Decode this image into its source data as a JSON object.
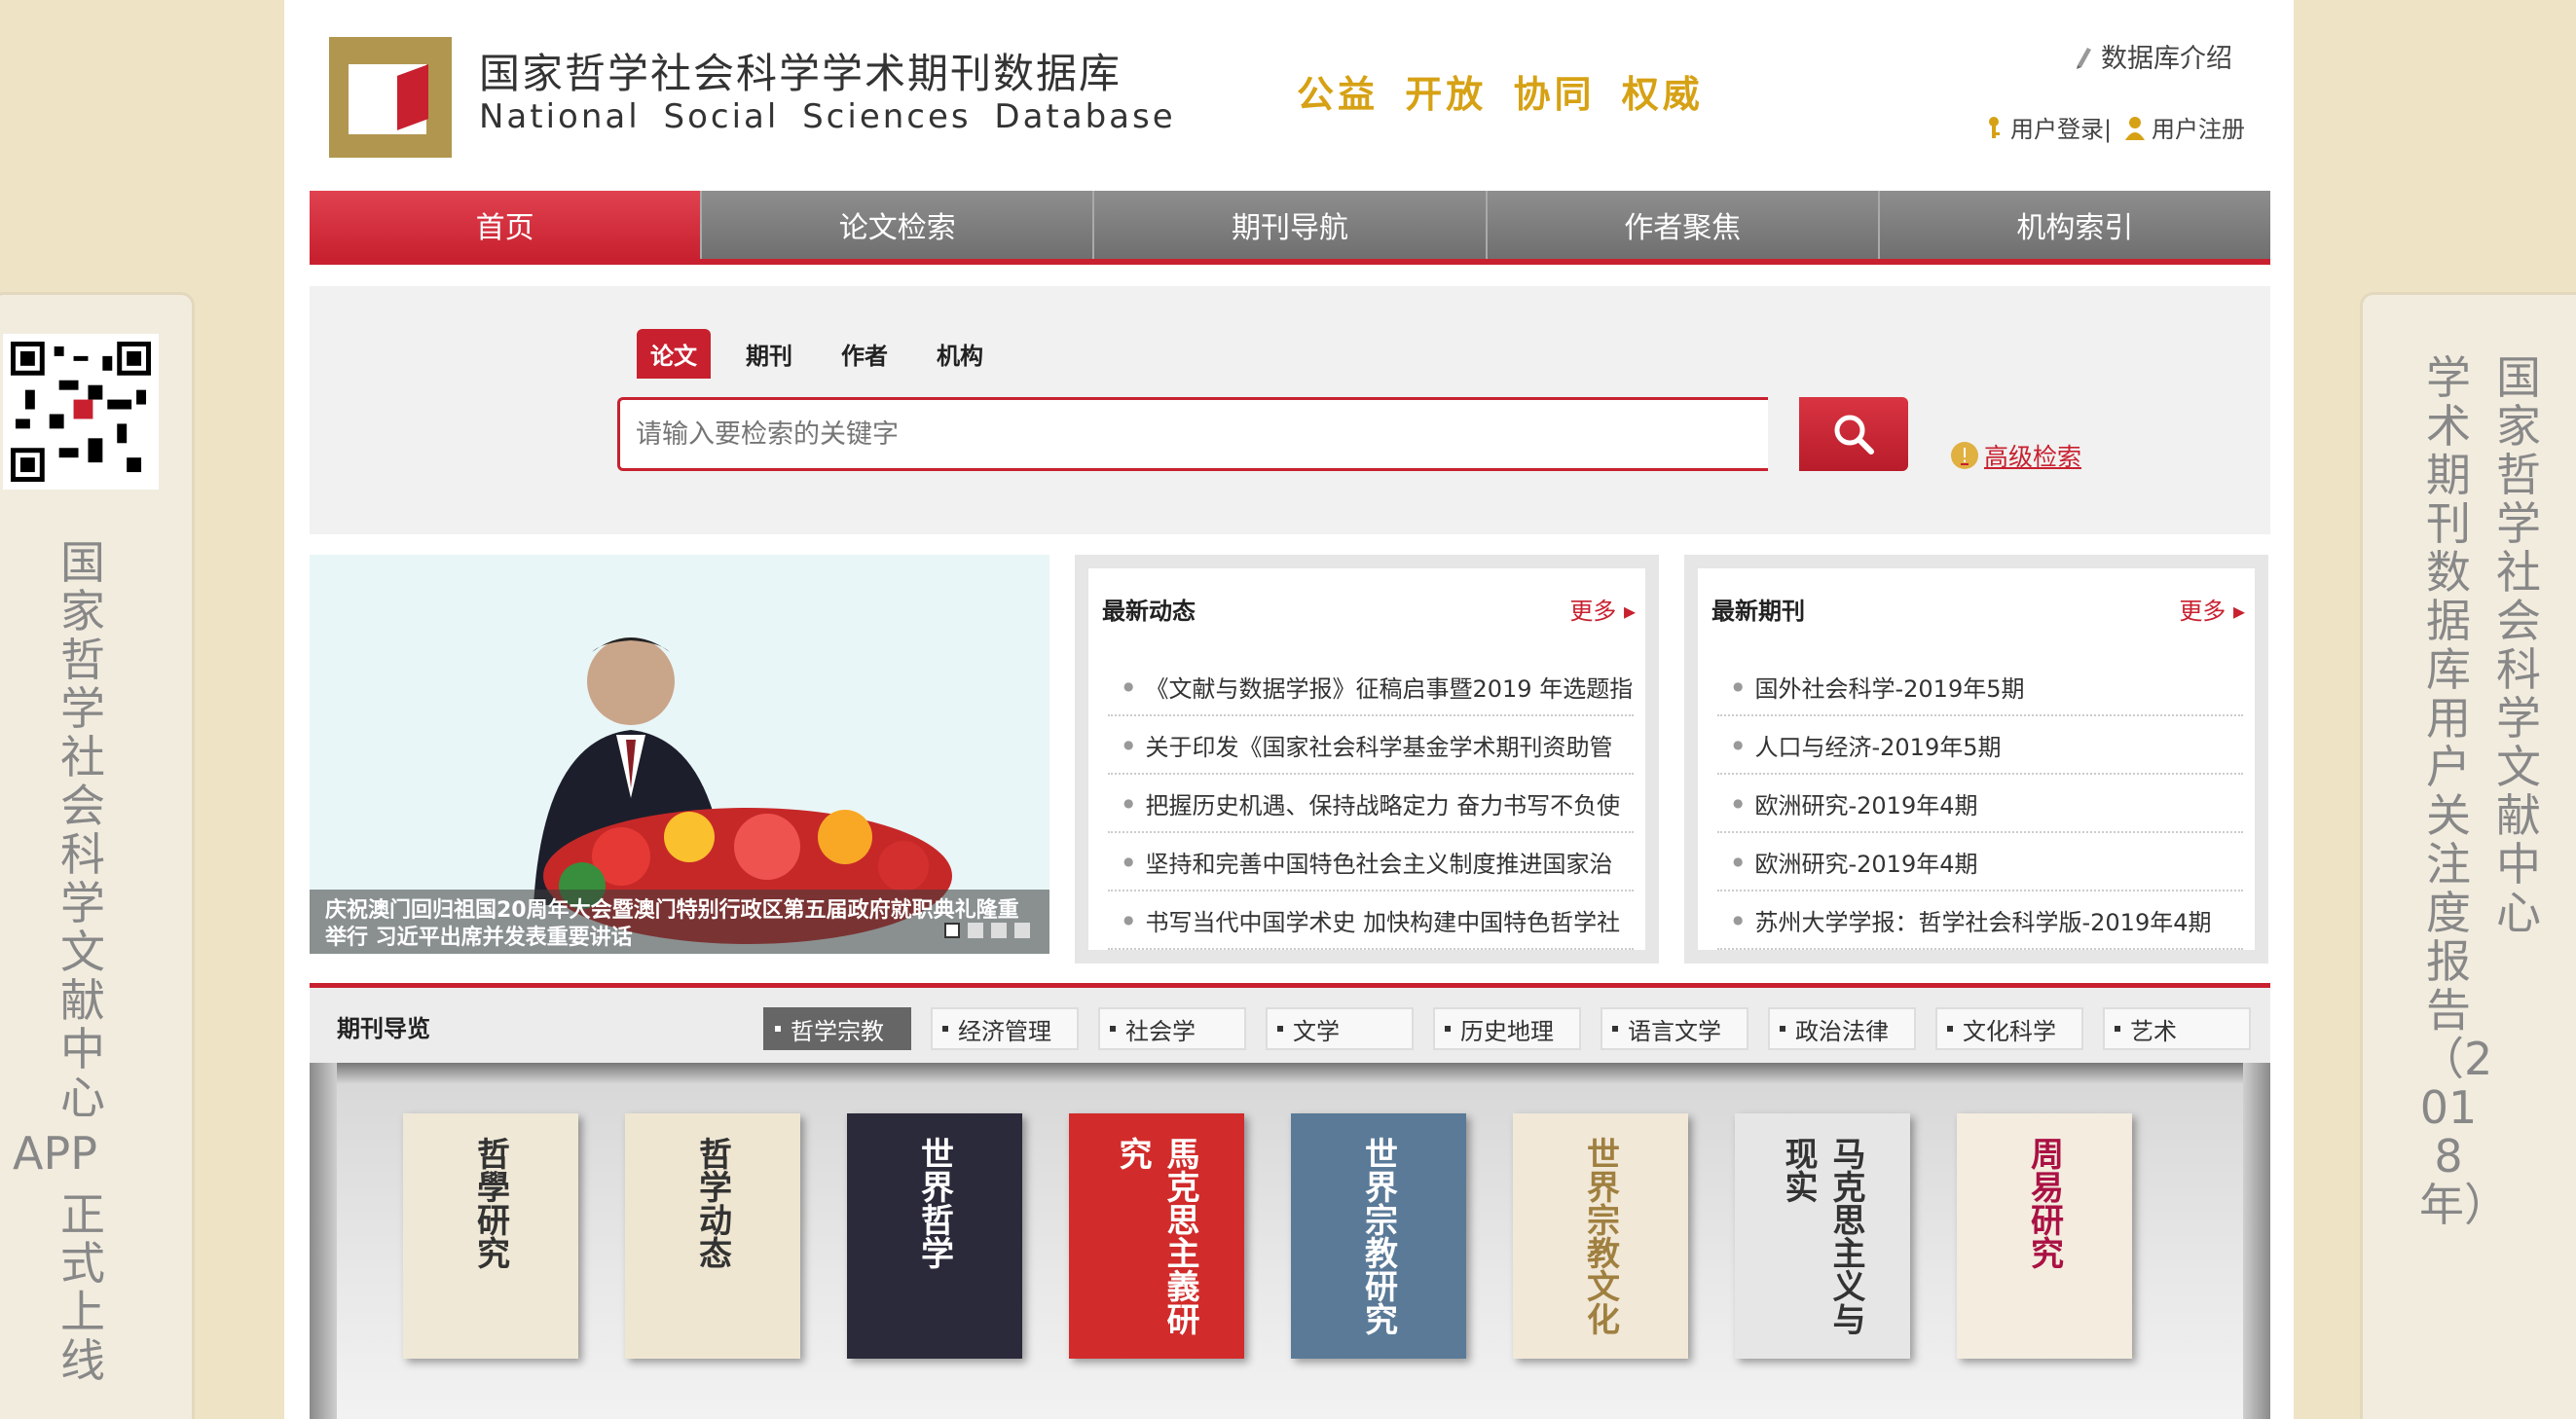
{
  "header": {
    "title_cn": "国家哲学社会科学学术期刊数据库",
    "title_en": "National Social Sciences Database",
    "slogan": "公益 开放 协同 权威",
    "intro_link": "数据库介绍",
    "login_link": "用户登录|",
    "register_link": "用户注册"
  },
  "nav": {
    "items": [
      "首页",
      "论文检索",
      "期刊导航",
      "作者聚焦",
      "机构索引"
    ]
  },
  "search": {
    "tabs": [
      "论文",
      "期刊",
      "作者",
      "机构"
    ],
    "placeholder": "请输入要检索的关键字",
    "advanced": "高级检索"
  },
  "banner": {
    "caption": "庆祝澳门回归祖国20周年大会暨澳门特别行政区第五届政府就职典礼隆重举行 习近平出席并发表重要讲话"
  },
  "news": {
    "title": "最新动态",
    "more": "更多 ▸",
    "items": [
      "《文献与数据学报》征稿启事暨2019 年选题指",
      "关于印发《国家社会科学基金学术期刊资助管",
      "把握历史机遇、保持战略定力 奋力书写不负使",
      "坚持和完善中国特色社会主义制度推进国家治",
      "书写当代中国学术史 加快构建中国特色哲学社"
    ]
  },
  "journals": {
    "title": "最新期刊",
    "more": "更多 ▸",
    "items": [
      "国外社会科学-2019年5期",
      "人口与经济-2019年5期",
      "欧洲研究-2019年4期",
      "欧洲研究-2019年4期",
      "苏州大学学报：哲学社会科学版-2019年4期"
    ]
  },
  "guide": {
    "title": "期刊导览",
    "categories": [
      "哲学宗教",
      "经济管理",
      "社会学",
      "文学",
      "历史地理",
      "语言文学",
      "政治法律",
      "文化科学",
      "艺术"
    ]
  },
  "books": [
    {
      "title": "哲學研究",
      "color": "#efe8d6"
    },
    {
      "title": "哲学动态",
      "color": "#efe6d2"
    },
    {
      "title": "世界哲学",
      "color": "#2b2a3a"
    },
    {
      "title": "馬克思主義研究",
      "color": "#d22b2b"
    },
    {
      "title": "世界宗教研究",
      "color": "#5a7a98"
    },
    {
      "title": "世界宗教文化",
      "color": "#f1e8d8"
    },
    {
      "title": "马克思主义与现实",
      "color": "#e6e6e6"
    },
    {
      "title": "周易研究",
      "color": "#f3ecdf"
    }
  ],
  "side_left": {
    "text": "国家哲学社会科学文献中心",
    "app": "APP",
    "text2": "正式上线"
  },
  "side_right": {
    "col1": "国家哲学社会科学文献中心",
    "col2": "学术期刊数据库用户关注度报告（2018年）"
  }
}
